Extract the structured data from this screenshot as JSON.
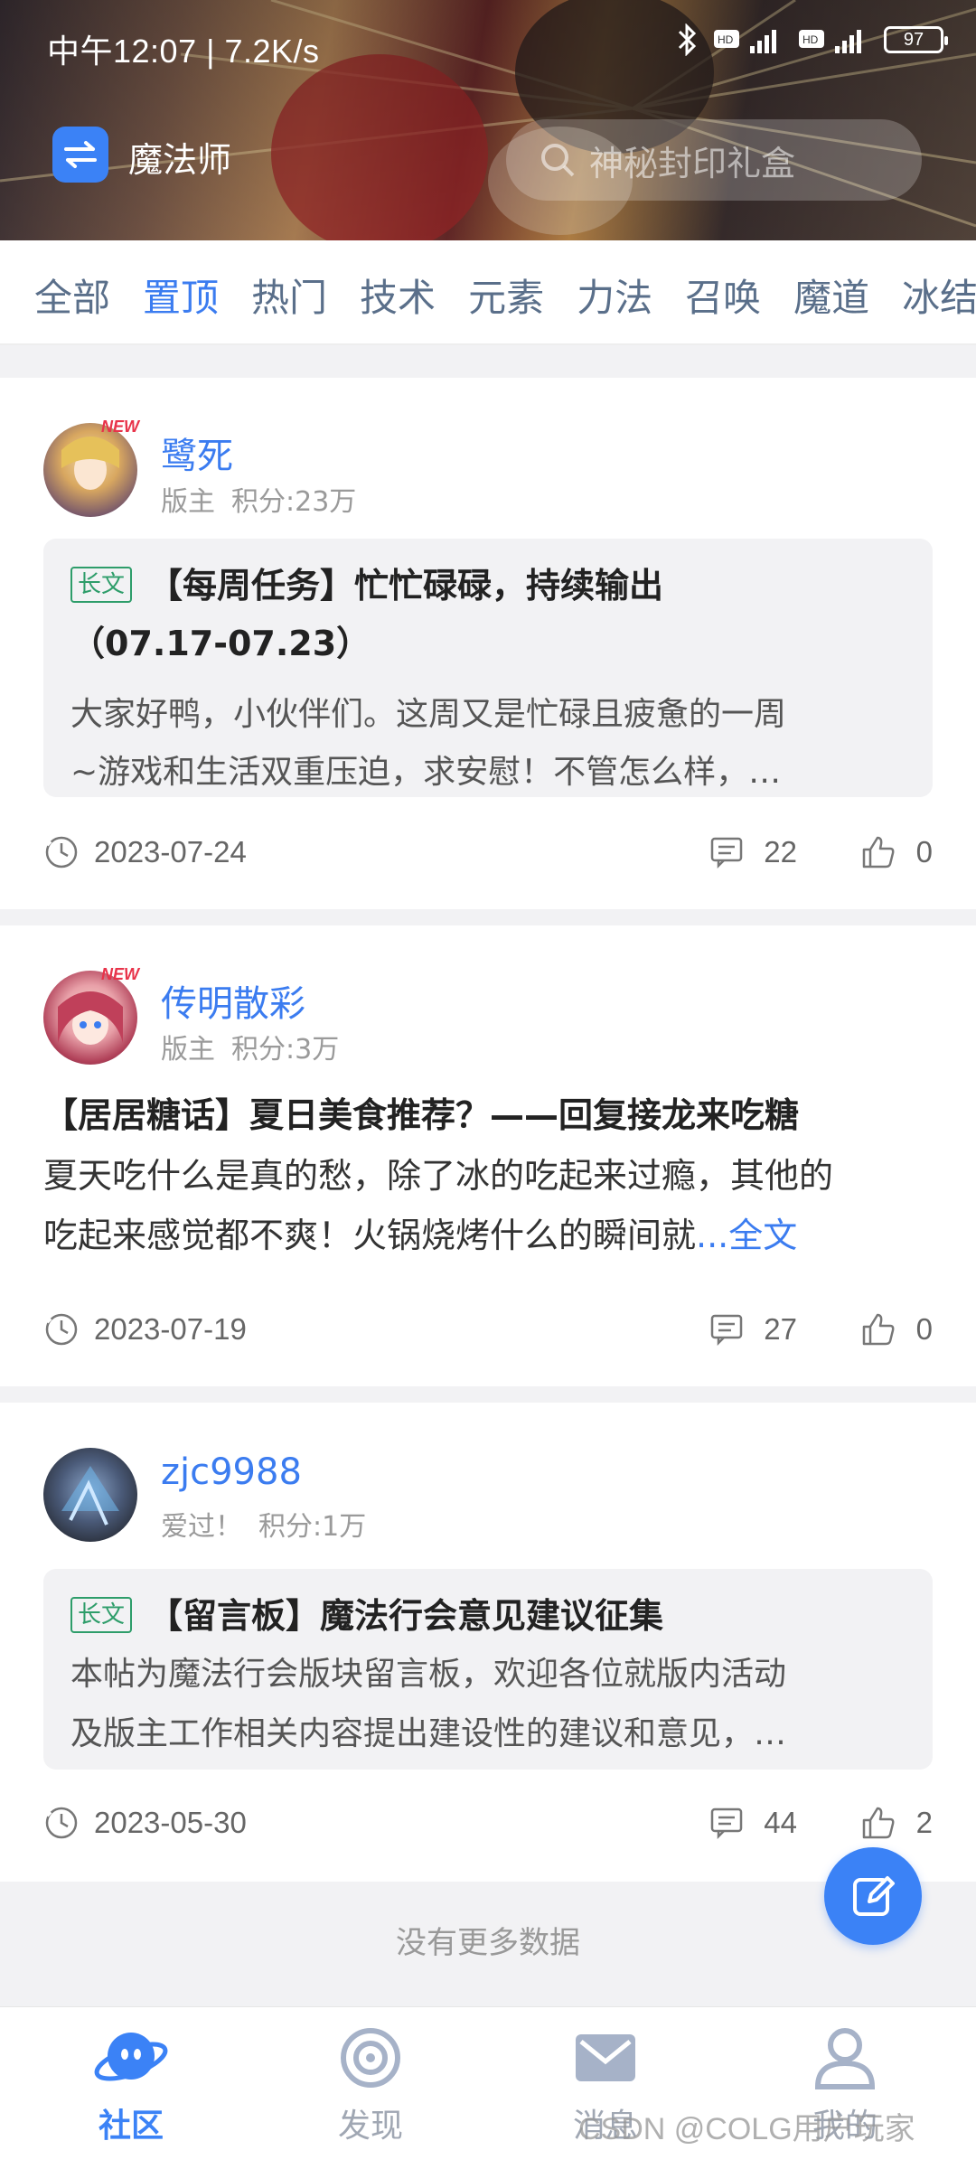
{
  "status_bar": {
    "time": "中午12:07 | 7.2K/s",
    "battery": "97"
  },
  "header": {
    "section_name": "魔法师",
    "search_placeholder": "神秘封印礼盒"
  },
  "tabs": [
    "全部",
    "置顶",
    "热门",
    "技术",
    "元素",
    "力法",
    "召唤",
    "魔道",
    "冰结"
  ],
  "active_tab": "置顶",
  "posts": [
    {
      "user": "鹭死",
      "role": "版主",
      "score": "积分:23万",
      "badge": "NEW",
      "tag": "长文",
      "title_line1": "【每周任务】忙忙碌碌，持续输出",
      "title_line2": "（07.17-07.23）",
      "body_line1": "大家好鸭，小伙伴们。这周又是忙碌且疲惫的一周",
      "body_line2": "~游戏和生活双重压迫，求安慰！不管怎么样，…",
      "date": "2023-07-24",
      "comments": "22",
      "likes": "0"
    },
    {
      "user": "传明散彩",
      "role": "版主",
      "score": "积分:3万",
      "badge": "NEW",
      "title_line1": "【居居糖话】夏日美食推荐？——回复接龙来吃糖",
      "body_line1": "夏天吃什么是真的愁，除了冰的吃起来过瘾，其他的",
      "body_line2": "吃起来感觉都不爽！火锅烧烤什么的瞬间就",
      "more": "...全文",
      "date": "2023-07-19",
      "comments": "27",
      "likes": "0"
    },
    {
      "user": "zjc9988",
      "role": "爱过！",
      "score": "积分:1万",
      "tag": "长文",
      "title_line1": "【留言板】魔法行会意见建议征集",
      "body_line1": "本帖为魔法行会版块留言板，欢迎各位就版内活动",
      "body_line2": "及版主工作相关内容提出建设性的建议和意见，…",
      "date": "2023-05-30",
      "comments": "44",
      "likes": "2"
    }
  ],
  "no_more": "没有更多数据",
  "bottom_nav": [
    "社区",
    "发现",
    "消息",
    "我的"
  ],
  "watermark": "CSDN @COLG用户玩家",
  "colors": {
    "accent": "#3b82f6",
    "link": "#3b7cf0",
    "tag_green": "#2e9d6a"
  }
}
